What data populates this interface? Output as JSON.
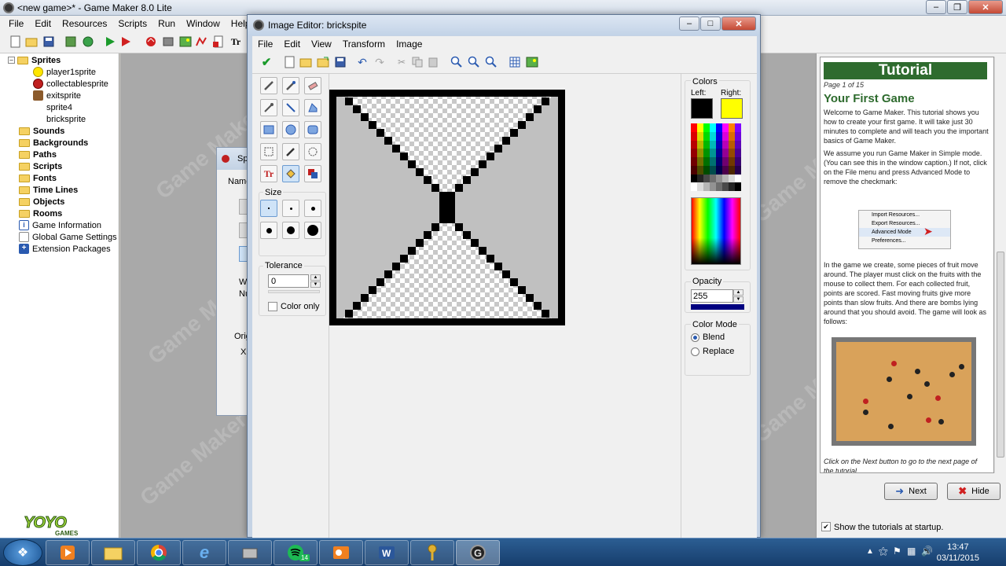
{
  "main_window": {
    "title": "<new game>* - Game Maker 8.0 Lite",
    "menu": [
      "File",
      "Edit",
      "Resources",
      "Scripts",
      "Run",
      "Window",
      "Help"
    ]
  },
  "resource_tree": {
    "items": [
      {
        "label": "Sprites",
        "type": "folder",
        "bold": true
      },
      {
        "label": "player1sprite",
        "type": "sprite"
      },
      {
        "label": "collectablesprite",
        "type": "sprite"
      },
      {
        "label": "exitsprite",
        "type": "sprite"
      },
      {
        "label": "sprite4",
        "type": "sprite"
      },
      {
        "label": "bricksprite",
        "type": "sprite"
      },
      {
        "label": "Sounds",
        "type": "folder",
        "bold": true
      },
      {
        "label": "Backgrounds",
        "type": "folder",
        "bold": true
      },
      {
        "label": "Paths",
        "type": "folder",
        "bold": true
      },
      {
        "label": "Scripts",
        "type": "folder",
        "bold": true
      },
      {
        "label": "Fonts",
        "type": "folder",
        "bold": true
      },
      {
        "label": "Time Lines",
        "type": "folder",
        "bold": true
      },
      {
        "label": "Objects",
        "type": "folder",
        "bold": true
      },
      {
        "label": "Rooms",
        "type": "folder",
        "bold": true
      },
      {
        "label": "Game Information",
        "type": "info"
      },
      {
        "label": "Global Game Settings",
        "type": "settings"
      },
      {
        "label": "Extension Packages",
        "type": "extension"
      }
    ]
  },
  "logo": {
    "yoyo": "YOYO",
    "games": "GAMES"
  },
  "watermark": "Game Maker",
  "sprite_dialog": {
    "title": "Sp",
    "name_label": "Name",
    "partial_labels": [
      "W",
      "Nu",
      "Origi",
      "X"
    ]
  },
  "image_editor": {
    "title": "Image Editor: brickspite",
    "menu": [
      "File",
      "Edit",
      "View",
      "Transform",
      "Image"
    ],
    "size_label": "Size",
    "tolerance_label": "Tolerance",
    "tolerance_value": "0",
    "color_only_label": "Color only",
    "colors_label": "Colors",
    "left_label": "Left:",
    "right_label": "Right:",
    "left_color": "#000000",
    "right_color": "#ffff00",
    "opacity_label": "Opacity",
    "opacity_value": "255",
    "color_mode_label": "Color Mode",
    "blend_label": "Blend",
    "replace_label": "Replace",
    "color_mode_selected": "Blend"
  },
  "tutorial": {
    "header": "Tutorial",
    "page": "Page 1 of 15",
    "title": "Your First Game",
    "p1": "Welcome to Game Maker. This tutorial shows you how to create your first game. It will take just 30 minutes to complete and will teach you the important basics of Game Maker.",
    "p2": "We assume you run Game Maker in Simple mode. (You can see this in the window caption.) If not, click on the File menu and press Advanced Mode to remove the checkmark:",
    "menu_img_items": [
      "Import Resources...",
      "Export Resources...",
      "Advanced Mode",
      "Preferences..."
    ],
    "p3": "In the game we create, some pieces of fruit move around. The player must click on the fruits with the mouse to collect them. For each collected fruit, points are scored. Fast moving fruits give more points than slow fruits. And there are bombs lying around that you should avoid. The game will look as follows:",
    "p4": "Click on the Next button to go to the next page of the tutorial.",
    "next_label": "Next",
    "hide_label": "Hide",
    "show_startup_label": "Show the tutorials at startup."
  },
  "taskbar": {
    "spotify_badge": "14",
    "time": "13:47",
    "date": "03/11/2015"
  }
}
